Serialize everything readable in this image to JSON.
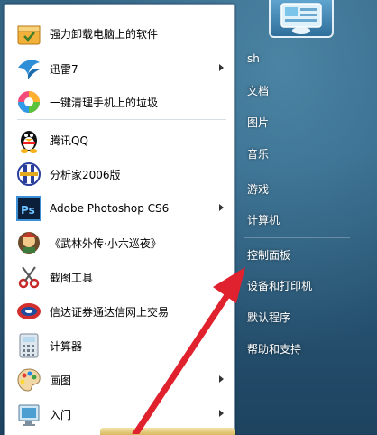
{
  "programs": [
    {
      "label": "强力卸载电脑上的软件",
      "icon": "uninstall-box-icon",
      "has_submenu": false
    },
    {
      "label": "迅雷7",
      "icon": "xunlei-bird-icon",
      "has_submenu": true
    },
    {
      "label": "一键清理手机上的垃圾",
      "icon": "phone-cleaner-icon",
      "has_submenu": false
    },
    {
      "label": "腾讯QQ",
      "icon": "qq-penguin-icon",
      "has_submenu": false
    },
    {
      "label": "分析家2006版",
      "icon": "analyst-icon",
      "has_submenu": false
    },
    {
      "label": "Adobe Photoshop CS6",
      "icon": "photoshop-icon",
      "has_submenu": true
    },
    {
      "label": "《武林外传·小六巡夜》",
      "icon": "game-icon",
      "has_submenu": false
    },
    {
      "label": "截图工具",
      "icon": "snipping-tool-icon",
      "has_submenu": false
    },
    {
      "label": "信达证券通达信网上交易",
      "icon": "stock-trading-icon",
      "has_submenu": false
    },
    {
      "label": "计算器",
      "icon": "calculator-icon",
      "has_submenu": false
    },
    {
      "label": "画图",
      "icon": "paint-icon",
      "has_submenu": true
    },
    {
      "label": "入门",
      "icon": "getting-started-icon",
      "has_submenu": true
    }
  ],
  "right_pane": [
    {
      "label": "sh"
    },
    {
      "label": "文档"
    },
    {
      "label": "图片"
    },
    {
      "label": "音乐"
    },
    {
      "label": "游戏"
    },
    {
      "label": "计算机"
    },
    {
      "label": "控制面板"
    },
    {
      "label": "设备和打印机"
    },
    {
      "label": "默认程序"
    },
    {
      "label": "帮助和支持"
    }
  ],
  "colors": {
    "annotation_arrow": "#e0222e",
    "menu_text": "#000000",
    "right_text": "#ffffff"
  }
}
